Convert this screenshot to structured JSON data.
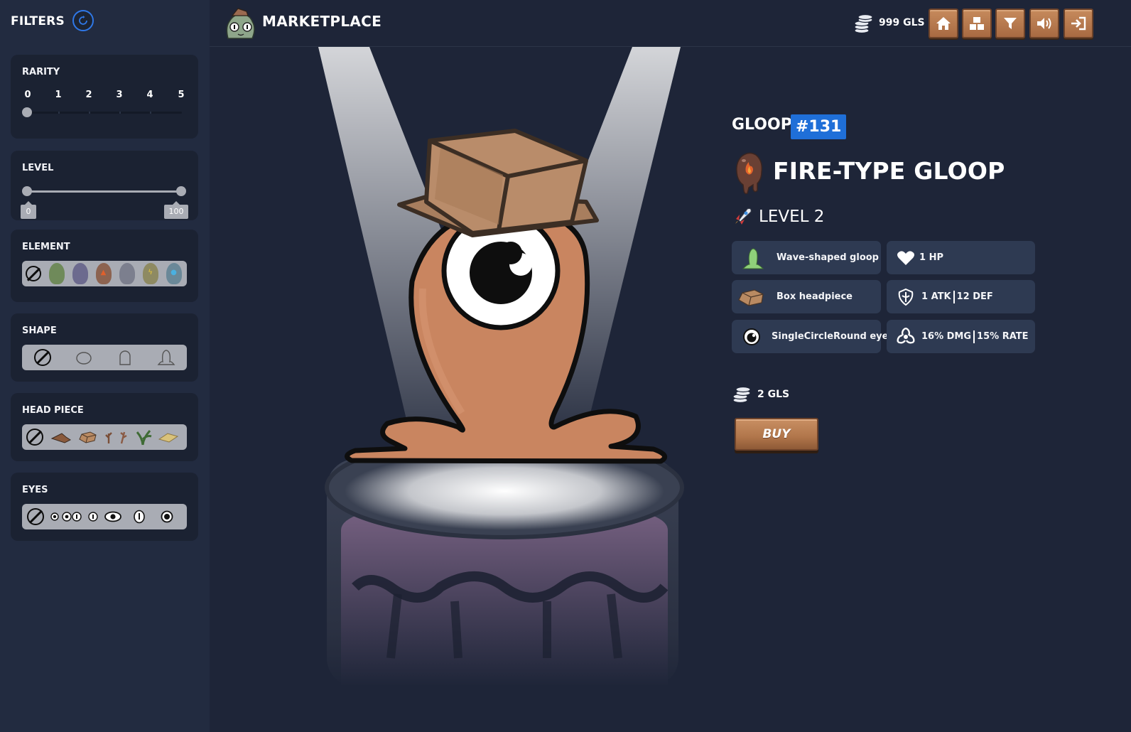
{
  "sidebar": {
    "title": "FILTERS",
    "rarity": {
      "label": "RARITY",
      "ticks": [
        "0",
        "1",
        "2",
        "3",
        "4",
        "5"
      ],
      "selected": 0
    },
    "level": {
      "label": "LEVEL",
      "min_value": "0",
      "max_value": "100"
    },
    "element": {
      "label": "ELEMENT",
      "options": [
        "none-icon",
        "earth-gloop-icon",
        "shadow-gloop-icon",
        "fire-gloop-icon",
        "air-gloop-icon",
        "electric-gloop-icon",
        "water-gloop-icon"
      ]
    },
    "shape": {
      "label": "SHAPE",
      "options": [
        "none-icon",
        "round-shape-icon",
        "tall-shape-icon",
        "wave-shape-icon"
      ]
    },
    "head_piece": {
      "label": "HEAD PIECE",
      "options": [
        "none-icon",
        "cap-headpiece-icon",
        "box-headpiece-icon",
        "twig-headpiece-icon",
        "branch-headpiece-icon",
        "leaf-headpiece-icon",
        "scroll-headpiece-icon"
      ]
    },
    "eyes": {
      "label": "EYES",
      "options": [
        "none-icon",
        "single-small-eye-icon",
        "double-eye-icon",
        "triple-eye-icon",
        "single-round-eye-icon",
        "wide-eye-icon",
        "slit-eye-icon",
        "single-circle-eye-icon"
      ]
    }
  },
  "topbar": {
    "title": "MARKETPLACE",
    "balance": "999 GLS",
    "nav": [
      "home-icon",
      "inventory-icon",
      "filter-icon",
      "sound-icon",
      "logout-icon"
    ]
  },
  "detail": {
    "label": "GLOOP",
    "id": "#131",
    "type_title": "FIRE-TYPE GLOOP",
    "level": "LEVEL 2",
    "attributes": {
      "shape": "Wave-shaped gloop",
      "hp": "1 HP",
      "headpiece": "Box headpiece",
      "atk": "1 ATK",
      "def": "12 DEF",
      "eyes": "SingleCircleRound eyes",
      "dmg": "16% DMG",
      "rate": "15% RATE"
    },
    "price": "2 GLS",
    "buy_label": "BUY"
  },
  "colors": {
    "accent": "#1f6fd8",
    "background": "#1e2538",
    "sidebar": "#222b40",
    "card": "#1b2232",
    "attribute_tile": "#2e3a52",
    "wood": "#b0754a",
    "gloop_body": "#c98560"
  }
}
